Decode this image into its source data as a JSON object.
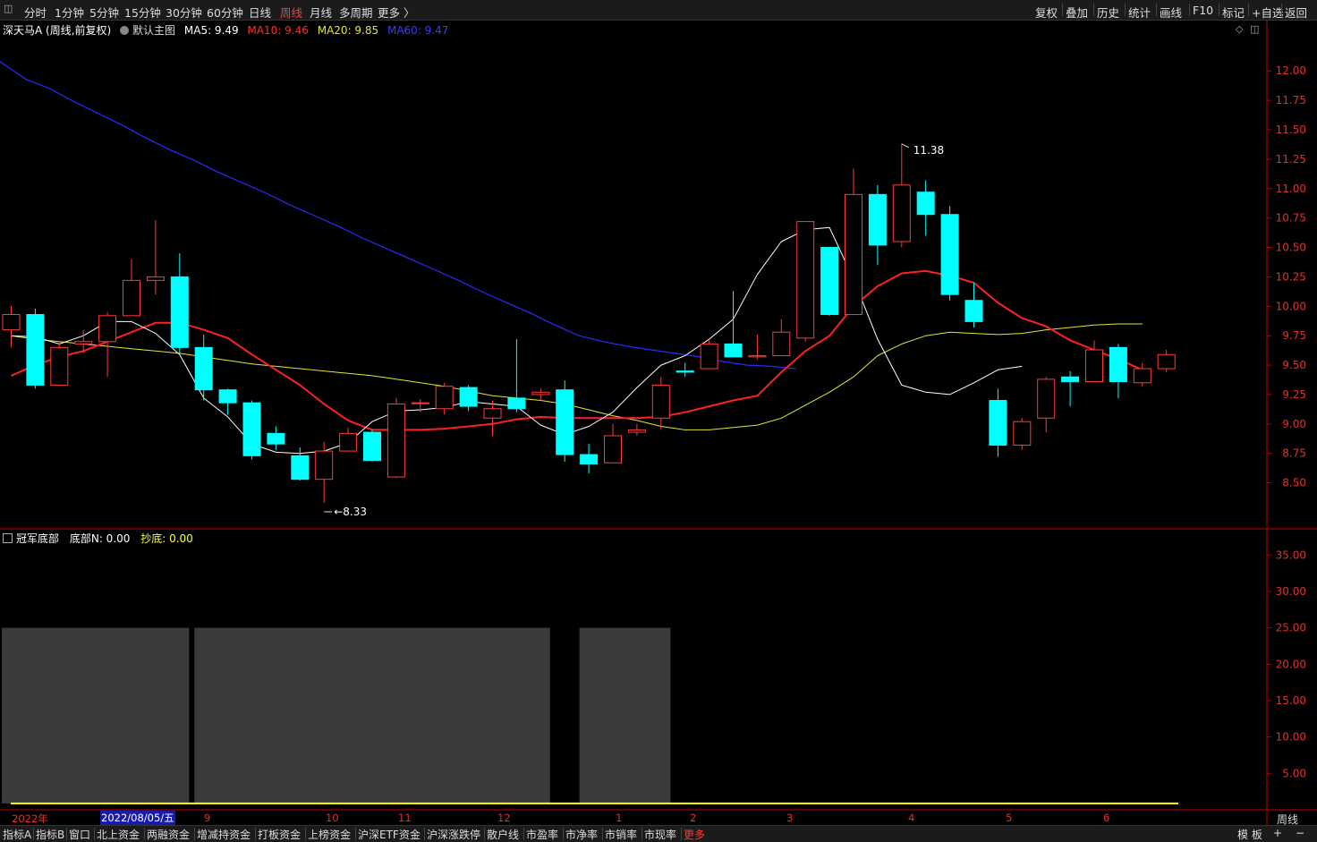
{
  "topbar": {
    "periods": [
      "分时",
      "1分钟",
      "5分钟",
      "15分钟",
      "30分钟",
      "60分钟",
      "日线",
      "周线",
      "月线",
      "多周期",
      "更多 〉"
    ],
    "active_period": "周线",
    "right_tools": [
      "复权",
      "叠加",
      "历史",
      "统计",
      "画线",
      "F10",
      "标记",
      "+自选",
      "返回"
    ]
  },
  "legend": {
    "stock": "深天马A (周线,前复权)",
    "template": "默认主图",
    "ma5": "MA5: 9.49",
    "ma10": "MA10: 9.46",
    "ma20": "MA20: 9.85",
    "ma60": "MA60: 9.47"
  },
  "sub_legend": {
    "name": "冠军底部",
    "n": "底部N: 0.00",
    "chaodi": "抄底: 0.00"
  },
  "colors": {
    "up": "#ff3b3b",
    "down": "#00ffff",
    "ma5": "#ffffff",
    "ma10": "#ff2020",
    "ma20": "#e6e62e",
    "ma60": "#2a2aff",
    "axis": "#c00000",
    "axis_text": "#e03030",
    "sub_bar": "#3a3a3a",
    "sub_line": "#ffff00"
  },
  "annotations": {
    "high": "11.38",
    "low": "8.33"
  },
  "x_axis": {
    "start": "2022年",
    "cursor": "2022/08/05/五",
    "months": [
      "9",
      "10",
      "11",
      "12",
      "1",
      "2",
      "3",
      "4",
      "5",
      "6"
    ]
  },
  "period_label": "周线",
  "bottom_tabs": [
    "指标A",
    "指标B",
    "窗口",
    "北上资金",
    "两融资金",
    "增减持资金",
    "打板资金",
    "上榜资金",
    "沪深ETF资金",
    "沪深涨跌停",
    "散户线",
    "市盈率",
    "市净率",
    "市销率",
    "市现率",
    "更多"
  ],
  "bottom_right": [
    "模 板",
    "+",
    "−"
  ],
  "chart_data": [
    {
      "type": "candlestick",
      "ylim": [
        8.17,
        12.42
      ],
      "y_ticks": [
        "8.50",
        "8.75",
        "9.00",
        "9.25",
        "9.50",
        "9.75",
        "10.00",
        "10.25",
        "10.50",
        "10.75",
        "11.00",
        "11.25",
        "11.50",
        "11.75",
        "12.00"
      ],
      "candles": [
        [
          9.8,
          9.93,
          10.0,
          9.65
        ],
        [
          9.93,
          9.33,
          9.98,
          9.3
        ],
        [
          9.33,
          9.65,
          9.7,
          9.33
        ],
        [
          9.68,
          9.7,
          9.8,
          9.6
        ],
        [
          9.7,
          9.92,
          9.95,
          9.4
        ],
        [
          9.92,
          10.22,
          10.4,
          9.92
        ],
        [
          10.22,
          10.25,
          10.73,
          10.1
        ],
        [
          10.25,
          9.65,
          10.45,
          9.6
        ],
        [
          9.65,
          9.29,
          9.76,
          9.2
        ],
        [
          9.29,
          9.18,
          9.3,
          9.08
        ],
        [
          9.18,
          8.73,
          9.2,
          8.7
        ],
        [
          8.92,
          8.83,
          8.98,
          8.78
        ],
        [
          8.73,
          8.53,
          8.8,
          8.52
        ],
        [
          8.53,
          8.77,
          8.85,
          8.33
        ],
        [
          8.77,
          8.92,
          8.97,
          8.77
        ],
        [
          8.93,
          8.69,
          8.95,
          8.68
        ],
        [
          8.55,
          9.17,
          9.22,
          8.54
        ],
        [
          9.18,
          9.18,
          9.21,
          9.1
        ],
        [
          9.13,
          9.32,
          9.35,
          9.08
        ],
        [
          9.31,
          9.15,
          9.33,
          9.11
        ],
        [
          9.05,
          9.13,
          9.2,
          8.9
        ],
        [
          9.22,
          9.13,
          9.72,
          9.1
        ],
        [
          9.25,
          9.27,
          9.3,
          9.2
        ],
        [
          9.29,
          8.74,
          9.37,
          8.68
        ],
        [
          8.74,
          8.66,
          8.83,
          8.58
        ],
        [
          8.67,
          8.9,
          9.0,
          8.67
        ],
        [
          8.93,
          8.95,
          9.0,
          8.9
        ],
        [
          9.05,
          9.33,
          9.4,
          8.95
        ],
        [
          9.45,
          9.44,
          9.52,
          9.4
        ],
        [
          9.47,
          9.68,
          9.72,
          9.47
        ],
        [
          9.68,
          9.57,
          10.13,
          9.57
        ],
        [
          9.57,
          9.58,
          9.76,
          9.55
        ],
        [
          9.58,
          9.78,
          9.89,
          9.58
        ],
        [
          9.73,
          10.72,
          10.72,
          9.7
        ],
        [
          10.5,
          9.93,
          10.5,
          9.92
        ],
        [
          9.93,
          10.95,
          11.17,
          9.93
        ],
        [
          10.95,
          10.52,
          11.03,
          10.35
        ],
        [
          10.55,
          11.03,
          11.38,
          10.5
        ],
        [
          10.97,
          10.78,
          11.07,
          10.6
        ],
        [
          10.78,
          10.1,
          10.85,
          10.05
        ],
        [
          10.05,
          9.87,
          10.2,
          9.82
        ],
        [
          9.2,
          8.82,
          9.3,
          8.72
        ],
        [
          8.82,
          9.02,
          9.05,
          8.78
        ],
        [
          9.05,
          9.38,
          9.4,
          8.93
        ],
        [
          9.4,
          9.36,
          9.45,
          9.15
        ],
        [
          9.36,
          9.63,
          9.71,
          9.36
        ],
        [
          9.65,
          9.36,
          9.68,
          9.22
        ],
        [
          9.35,
          9.47,
          9.52,
          9.32
        ],
        [
          9.47,
          9.59,
          9.63,
          9.44
        ]
      ],
      "ma": {
        "ma5": [
          9.75,
          9.74,
          9.68,
          9.75,
          9.87,
          9.87,
          9.77,
          9.59,
          9.22,
          9.06,
          8.83,
          8.76,
          8.75,
          8.77,
          8.84,
          9.02,
          9.11,
          9.12,
          9.14,
          9.19,
          9.17,
          9.15,
          8.99,
          8.91,
          8.98,
          9.1,
          9.31,
          9.5,
          9.58,
          9.72,
          9.89,
          10.27,
          10.55,
          10.65,
          10.67,
          10.23,
          9.72,
          9.33,
          9.27,
          9.25,
          9.35,
          9.46,
          9.49
        ],
        "ma10": [
          9.41,
          9.5,
          9.57,
          9.62,
          9.7,
          9.78,
          9.86,
          9.86,
          9.8,
          9.73,
          9.59,
          9.46,
          9.33,
          9.17,
          9.03,
          8.95,
          8.95,
          8.95,
          8.96,
          8.98,
          9.0,
          9.04,
          9.06,
          9.05,
          9.05,
          9.05,
          9.05,
          9.06,
          9.1,
          9.15,
          9.2,
          9.24,
          9.44,
          9.62,
          9.75,
          10.0,
          10.17,
          10.28,
          10.3,
          10.26,
          10.2,
          10.03,
          9.9,
          9.83,
          9.71,
          9.63,
          9.55,
          9.46
        ],
        "ma20": [
          9.75,
          9.72,
          9.7,
          9.68,
          9.66,
          9.64,
          9.62,
          9.6,
          9.57,
          9.54,
          9.51,
          9.49,
          9.47,
          9.45,
          9.43,
          9.41,
          9.38,
          9.35,
          9.32,
          9.28,
          9.24,
          9.22,
          9.2,
          9.17,
          9.12,
          9.07,
          9.03,
          8.98,
          8.95,
          8.95,
          8.97,
          8.99,
          9.05,
          9.16,
          9.27,
          9.4,
          9.58,
          9.68,
          9.75,
          9.78,
          9.77,
          9.76,
          9.77,
          9.8,
          9.82,
          9.84,
          9.85,
          9.85
        ],
        "ma60": [
          12.22,
          12.07,
          11.93,
          11.85,
          11.74,
          11.64,
          11.54,
          11.43,
          11.33,
          11.24,
          11.14,
          11.05,
          10.96,
          10.86,
          10.77,
          10.68,
          10.58,
          10.49,
          10.4,
          10.31,
          10.22,
          10.12,
          10.03,
          9.94,
          9.84,
          9.75,
          9.7,
          9.66,
          9.63,
          9.6,
          9.57,
          9.53,
          9.5,
          9.49,
          9.47
        ]
      }
    },
    {
      "type": "bar",
      "ylim": [
        0,
        38.6
      ],
      "y_ticks": [
        "5.00",
        "10.00",
        "15.00",
        "20.00",
        "25.00",
        "30.00",
        "35.00"
      ],
      "bars": [
        {
          "from_week": 0,
          "to_week": 7,
          "value": 25
        },
        {
          "from_week": 8,
          "to_week": 22,
          "value": 25
        },
        {
          "from_week": 24,
          "to_week": 27,
          "value": 25
        }
      ],
      "baseline": 0.5
    }
  ]
}
